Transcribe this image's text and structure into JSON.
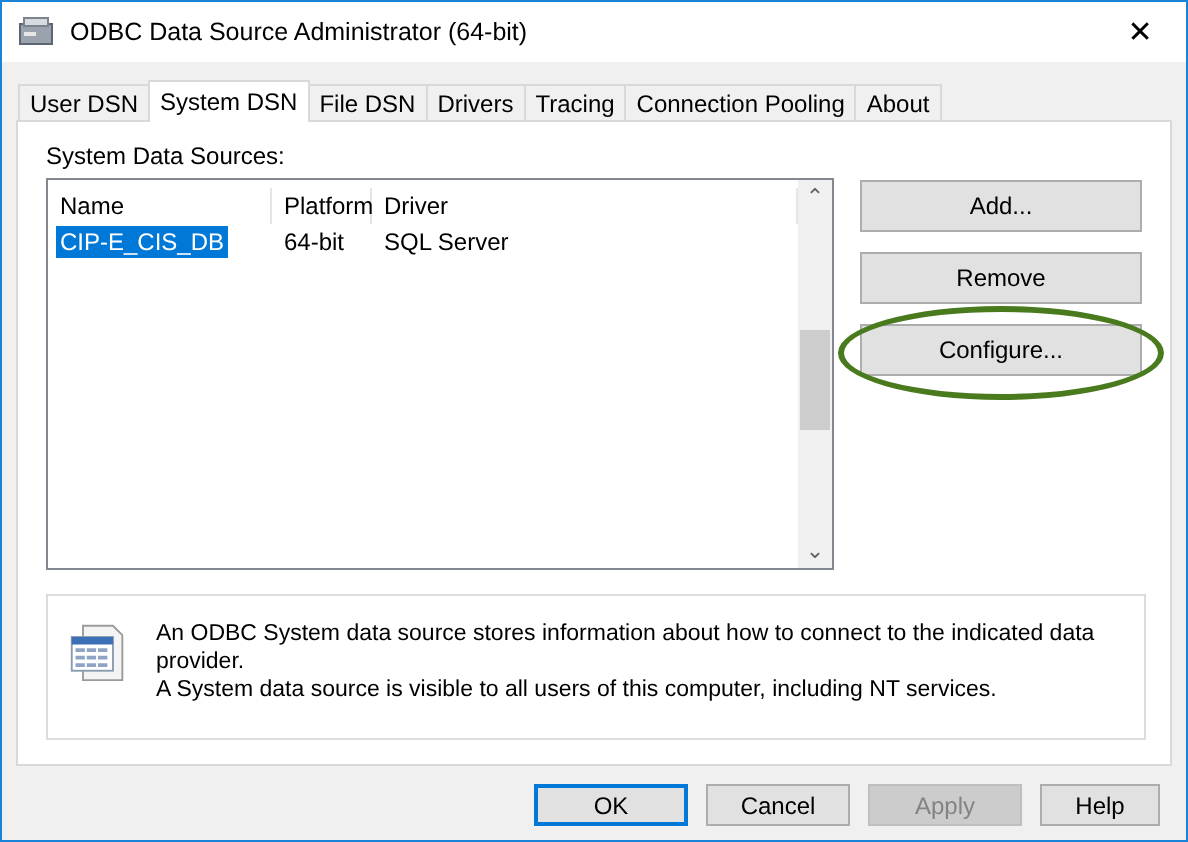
{
  "window": {
    "title": "ODBC Data Source Administrator (64-bit)",
    "close": "✕"
  },
  "tabs": [
    {
      "label": "User DSN",
      "selected": false
    },
    {
      "label": "System DSN",
      "selected": true
    },
    {
      "label": "File DSN",
      "selected": false
    },
    {
      "label": "Drivers",
      "selected": false
    },
    {
      "label": "Tracing",
      "selected": false
    },
    {
      "label": "Connection Pooling",
      "selected": false
    },
    {
      "label": "About",
      "selected": false
    }
  ],
  "list": {
    "label": "System Data Sources:",
    "columns": [
      "Name",
      "Platform",
      "Driver"
    ],
    "rows": [
      {
        "cells": [
          "CIP-E_CIS_DB",
          "64-bit",
          "SQL Server"
        ],
        "selected": true
      }
    ],
    "scroll_up": "⌃",
    "scroll_down": "⌄"
  },
  "side_buttons": [
    {
      "label": "Add...",
      "highlighted": false
    },
    {
      "label": "Remove",
      "highlighted": false
    },
    {
      "label": "Configure...",
      "highlighted": true
    }
  ],
  "info": {
    "lines": [
      "An ODBC System data source stores information about how to connect to the indicated data provider.",
      "A System data source is visible to all users of this computer, including NT services."
    ]
  },
  "footer_buttons": [
    {
      "label": "OK",
      "default": true,
      "disabled": false
    },
    {
      "label": "Cancel",
      "default": false,
      "disabled": false
    },
    {
      "label": "Apply",
      "default": false,
      "disabled": true
    },
    {
      "label": "Help",
      "default": false,
      "disabled": false
    }
  ]
}
